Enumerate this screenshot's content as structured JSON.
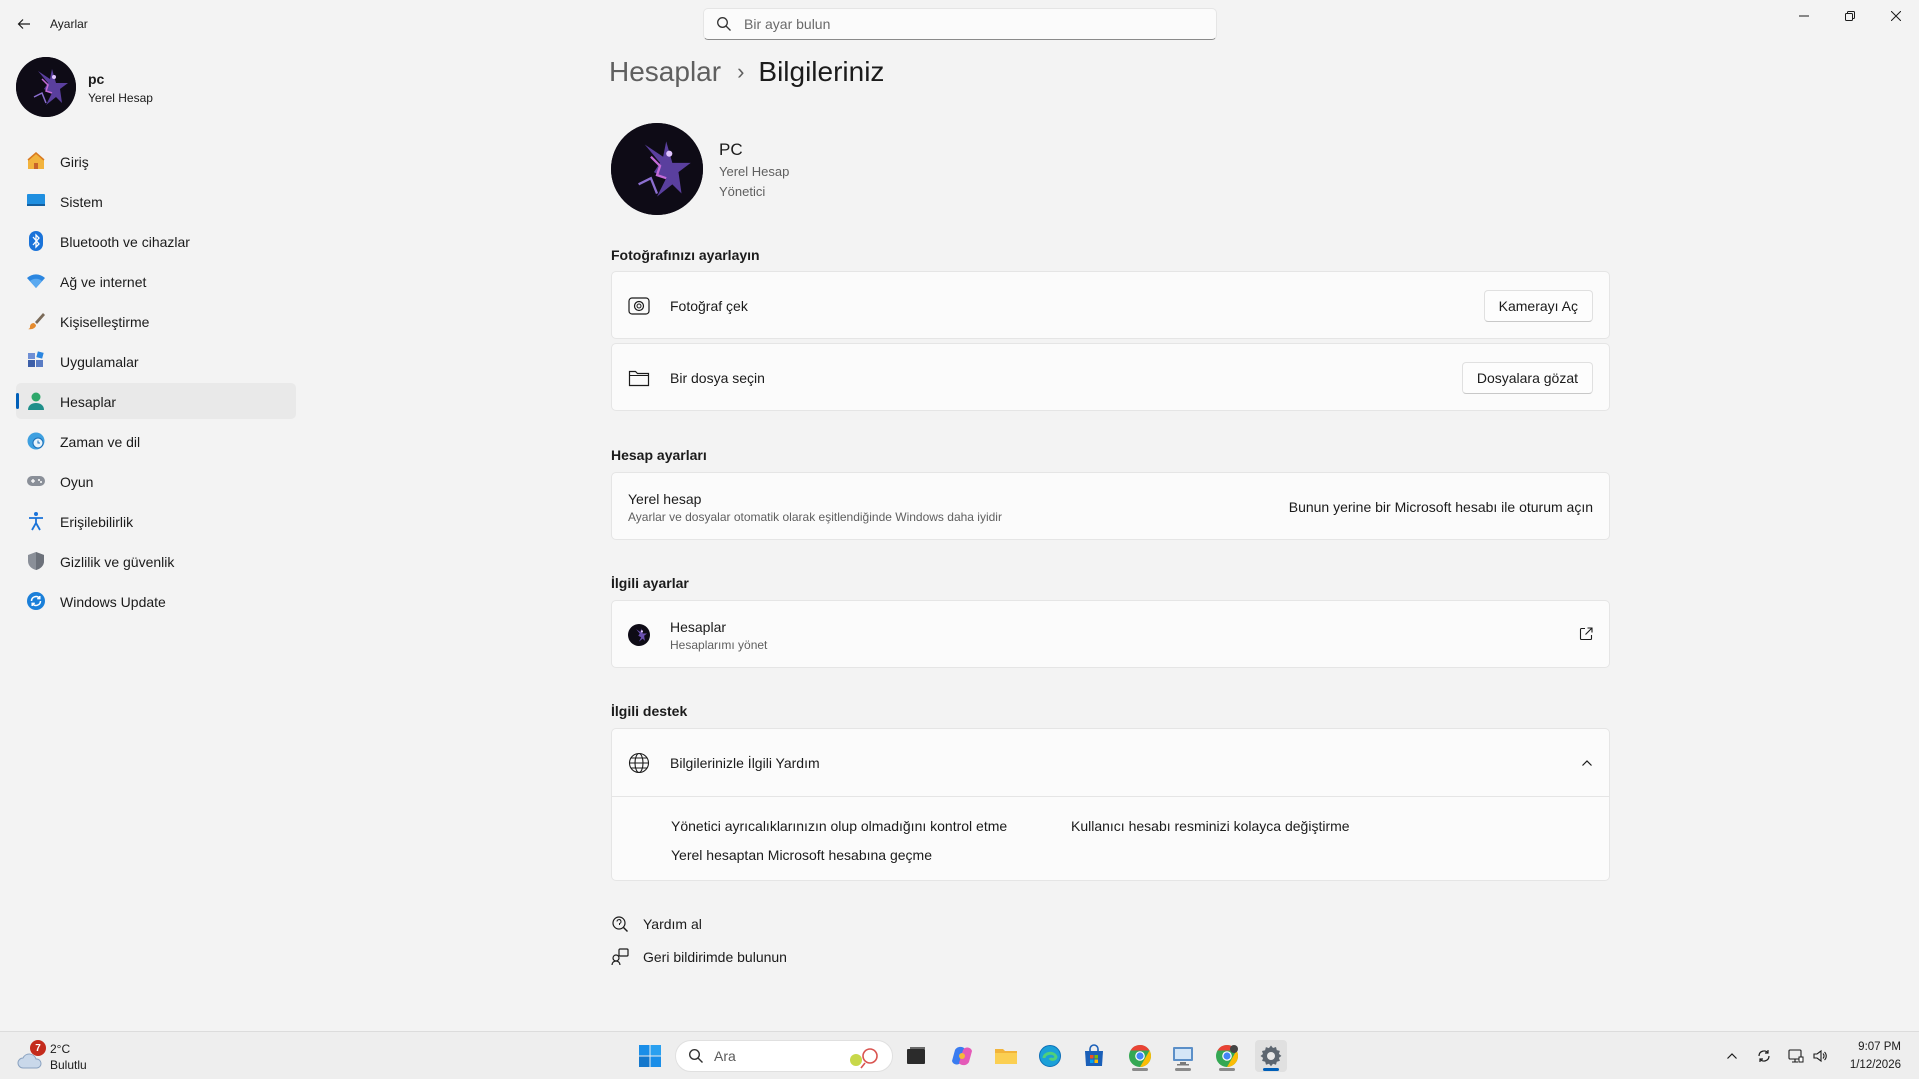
{
  "window": {
    "app_title": "Ayarlar",
    "search_placeholder": "Bir ayar bulun"
  },
  "profile": {
    "name": "pc",
    "account_type": "Yerel Hesap"
  },
  "sidebar": {
    "items": [
      {
        "label": "Giriş",
        "icon": "home-icon",
        "active": false
      },
      {
        "label": "Sistem",
        "icon": "system-icon",
        "active": false
      },
      {
        "label": "Bluetooth ve cihazlar",
        "icon": "bluetooth-icon",
        "active": false
      },
      {
        "label": "Ağ ve internet",
        "icon": "wifi-icon",
        "active": false
      },
      {
        "label": "Kişiselleştirme",
        "icon": "brush-icon",
        "active": false
      },
      {
        "label": "Uygulamalar",
        "icon": "apps-icon",
        "active": false
      },
      {
        "label": "Hesaplar",
        "icon": "person-icon",
        "active": true
      },
      {
        "label": "Zaman ve dil",
        "icon": "globe-clock-icon",
        "active": false
      },
      {
        "label": "Oyun",
        "icon": "gamepad-icon",
        "active": false
      },
      {
        "label": "Erişilebilirlik",
        "icon": "accessibility-icon",
        "active": false
      },
      {
        "label": "Gizlilik ve güvenlik",
        "icon": "shield-icon",
        "active": false
      },
      {
        "label": "Windows Update",
        "icon": "update-icon",
        "active": false
      }
    ]
  },
  "main": {
    "breadcrumb": {
      "parent": "Hesaplar",
      "separator": "›",
      "current": "Bilgileriniz"
    },
    "user": {
      "name": "PC",
      "account_type": "Yerel Hesap",
      "role": "Yönetici"
    },
    "photo_section": {
      "title": "Fotoğrafınızı ayarlayın",
      "take_photo_label": "Fotoğraf çek",
      "take_photo_button": "Kamerayı Aç",
      "choose_file_label": "Bir dosya seçin",
      "choose_file_button": "Dosyalara gözat"
    },
    "account_section": {
      "title": "Hesap ayarları",
      "local_label": "Yerel hesap",
      "local_desc": "Ayarlar ve dosyalar otomatik olarak eşitlendiğinde Windows daha iyidir",
      "signin_link": "Bunun yerine bir Microsoft hesabı ile oturum açın"
    },
    "related_settings": {
      "title": "İlgili ayarlar",
      "accounts_label": "Hesaplar",
      "accounts_desc": "Hesaplarımı yönet"
    },
    "related_support": {
      "title": "İlgili destek",
      "help_title": "Bilgilerinizle İlgili Yardım",
      "links": [
        "Yönetici ayrıcalıklarınızın olup olmadığını kontrol etme",
        "Kullanıcı hesabı resminizi kolayca değiştirme",
        "Yerel hesaptan Microsoft hesabına geçme"
      ]
    },
    "get_help": "Yardım al",
    "feedback": "Geri bildirimde bulunun"
  },
  "taskbar": {
    "weather_temp": "2°C",
    "weather_condition": "Bulutlu",
    "weather_badge": "7",
    "search_label": "Ara",
    "time": "9:07 PM",
    "date": "1/12/2026"
  },
  "colors": {
    "accent": "#005fb8",
    "background": "#f3f3f3",
    "card": "#fbfbfb"
  }
}
